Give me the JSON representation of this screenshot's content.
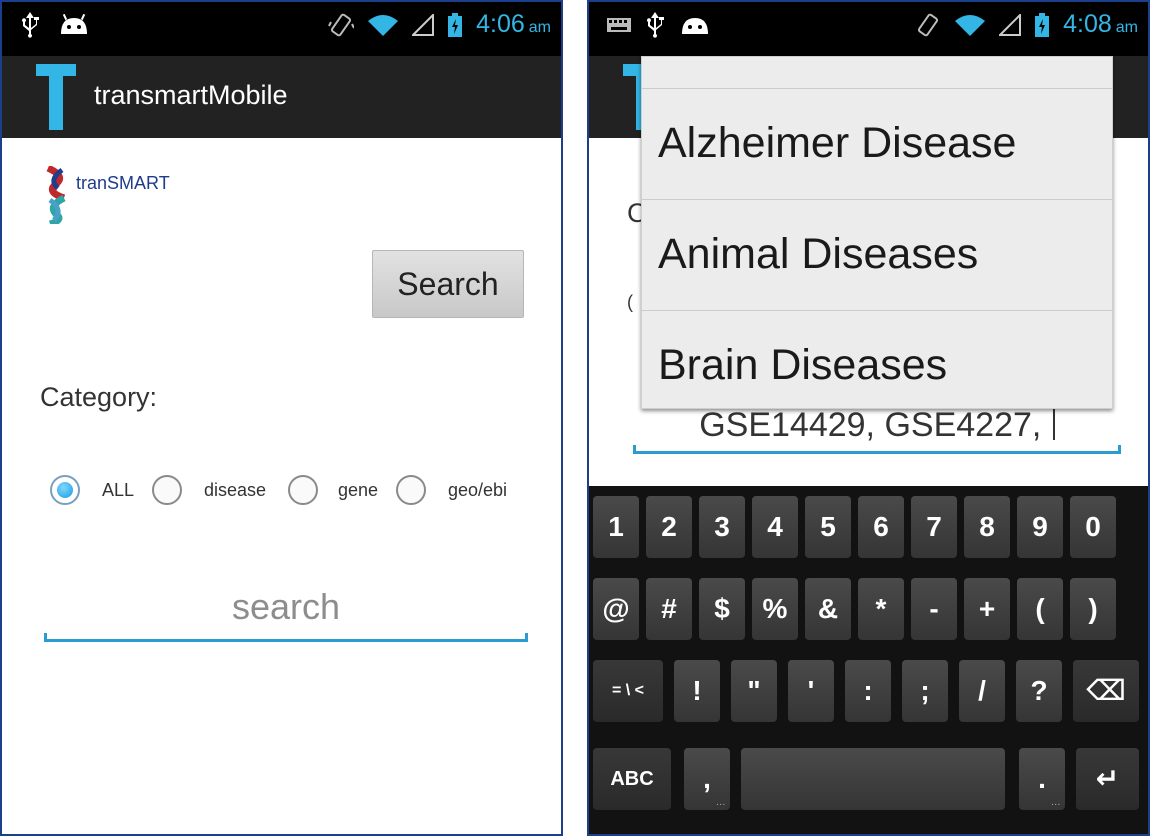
{
  "left_screen": {
    "status_bar": {
      "time": "4:06",
      "ampm": "am"
    },
    "action_bar": {
      "logo_letter": "T",
      "title": "transmartMobile"
    },
    "brand_logo_text": "tranSMART",
    "search_button_label": "Search",
    "category_label": "Category:",
    "radio_options": [
      {
        "label": "ALL",
        "checked": true
      },
      {
        "label": "disease",
        "checked": false
      },
      {
        "label": "gene",
        "checked": false
      },
      {
        "label": "geo/ebi",
        "checked": false
      }
    ],
    "search_field": {
      "placeholder": "search",
      "value": ""
    }
  },
  "right_screen": {
    "status_bar": {
      "time": "4:08",
      "ampm": "am"
    },
    "dropdown_items": [
      "Alzheimer Disease",
      "Animal Diseases",
      "Brain Diseases"
    ],
    "input_value": "GSE14429, GSE4227, ",
    "keyboard": {
      "row1": [
        "1",
        "2",
        "3",
        "4",
        "5",
        "6",
        "7",
        "8",
        "9",
        "0"
      ],
      "row2": [
        "@",
        "#",
        "$",
        "%",
        "&",
        "*",
        "-",
        "+",
        "(",
        ")"
      ],
      "row3": [
        "= \\ <",
        "!",
        "\"",
        "'",
        ":",
        ";",
        "/",
        "?",
        "⌫"
      ],
      "row4": [
        "ABC",
        ",",
        " ",
        ".",
        "↵"
      ]
    }
  },
  "colors": {
    "accent": "#33b5e5",
    "action_bar": "#222222",
    "keyboard_bg": "#121212"
  }
}
